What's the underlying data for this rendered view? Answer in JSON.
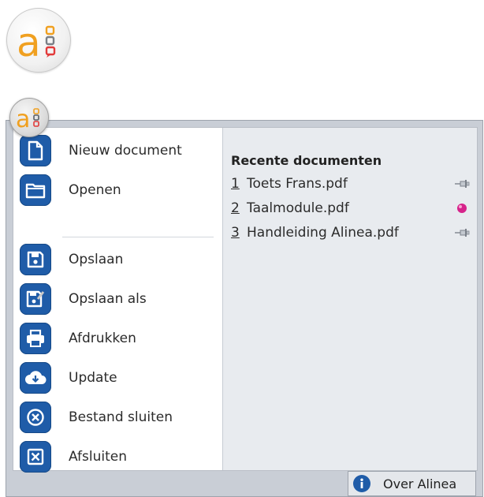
{
  "app": {
    "logo_icon": "alinea-logo-icon",
    "brand_colors": {
      "orange": "#f0a020",
      "red": "#e23a3a",
      "gray": "#7a7f86",
      "blue": "#1f5ca8"
    }
  },
  "menu": {
    "commands": [
      {
        "label": "Nieuw document",
        "icon": "new-document-icon"
      },
      {
        "label": "Openen",
        "icon": "folder-open-icon"
      },
      {
        "label": "Opslaan",
        "icon": "save-icon"
      },
      {
        "label": "Opslaan als",
        "icon": "save-as-icon"
      },
      {
        "label": "Afdrukken",
        "icon": "print-icon"
      },
      {
        "label": "Update",
        "icon": "cloud-download-icon"
      },
      {
        "label": "Bestand sluiten",
        "icon": "close-file-icon"
      },
      {
        "label": "Afsluiten",
        "icon": "exit-icon"
      }
    ]
  },
  "recent": {
    "title": "Recente documenten",
    "items": [
      {
        "num": "1",
        "name": "Toets Frans.pdf",
        "pinned": false
      },
      {
        "num": "2",
        "name": "Taalmodule.pdf",
        "pinned": true
      },
      {
        "num": "3",
        "name": "Handleiding Alinea.pdf",
        "pinned": false
      }
    ]
  },
  "footer": {
    "about_label": "Over Alinea",
    "about_icon": "info-icon"
  }
}
